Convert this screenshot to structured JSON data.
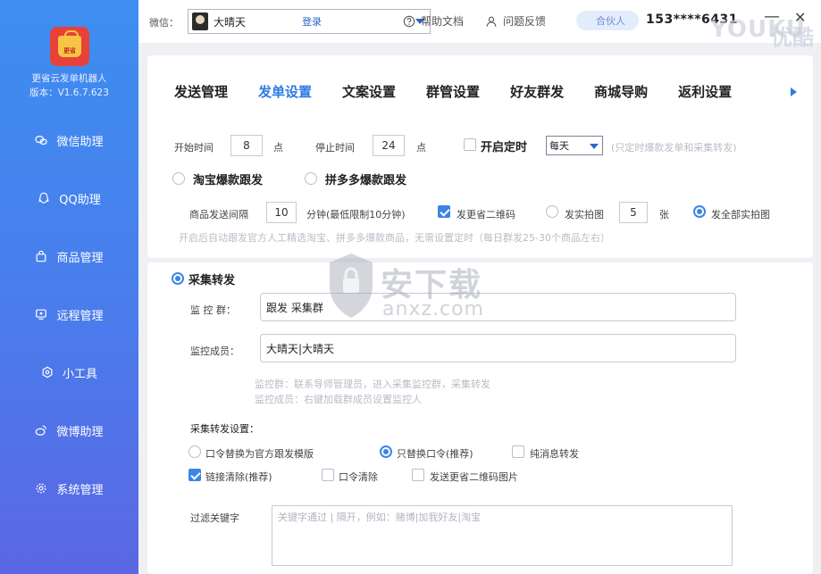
{
  "sidebar": {
    "logo_text": "更省",
    "app_name": "更省云发单机器人",
    "version": "版本：V1.6.7.623",
    "items": [
      {
        "label": "微信助理",
        "icon": "wechat-icon"
      },
      {
        "label": "QQ助理",
        "icon": "qq-icon"
      },
      {
        "label": "商品管理",
        "icon": "bag-icon"
      },
      {
        "label": "远程管理",
        "icon": "monitor-icon"
      },
      {
        "label": "小工具",
        "icon": "tool-icon"
      },
      {
        "label": "微博助理",
        "icon": "weibo-icon"
      },
      {
        "label": "系统管理",
        "icon": "gear-icon"
      }
    ]
  },
  "topbar": {
    "wechat_label": "微信：",
    "account_name": "大晴天",
    "login": "登录",
    "help": "帮助文档",
    "feedback": "问题反馈",
    "pill": "合伙人",
    "phone": "153****6431",
    "minimize": "—",
    "close": "✕",
    "watermark": "YOUKU",
    "watermark2": "优酷"
  },
  "tabs": [
    "发送管理",
    "发单设置",
    "文案设置",
    "群管设置",
    "好友群发",
    "商城导购",
    "返利设置"
  ],
  "schedule": {
    "start_label": "开始时间",
    "start_value": "8",
    "start_unit": "点",
    "stop_label": "停止时间",
    "stop_value": "24",
    "stop_unit": "点",
    "timer_label": "开启定时",
    "frequency": "每天",
    "timer_hint": "(只定时爆款发单和采集转发)"
  },
  "follow": {
    "taobao": "淘宝爆款跟发",
    "pdd": "拼多多爆款跟发",
    "interval_label": "商品发送间隔",
    "interval_value": "10",
    "interval_unit": "分钟(最低限制10分钟)",
    "qrcode_label": "发更省二维码",
    "photo_label": "发实拍图",
    "photo_count": "5",
    "photo_unit": "张",
    "all_photos_label": "发全部实拍图",
    "hint": "开启后自动跟发官方人工精选淘宝、拼多多爆款商品，无需设置定时（每日群发25-30个商品左右）"
  },
  "collect": {
    "title": "采集转发",
    "monitor_group_label": "监 控 群：",
    "monitor_group_value": "跟发  采集群",
    "monitor_member_label": "监控成员：",
    "monitor_member_value": "大晴天|大晴天",
    "hint1": "监控群：联系导师管理员，进入采集监控群，采集转发",
    "hint2": "监控成员：右键加载群成员设置监控人",
    "settings_title": "采集转发设置：",
    "opt_template": "口令替换为官方跟发模版",
    "opt_only_token": "只替换口令(推荐)",
    "opt_plain": "纯消息转发",
    "opt_clear_link": "链接清除(推荐)",
    "opt_clear_token": "口令清除",
    "opt_send_qr": "发送更省二维码图片",
    "filter_label": "过滤关键字",
    "filter_placeholder": "关键字通过 | 隔开，例如：赌博|加我好友|淘宝"
  },
  "center_watermark": {
    "title": "安下载",
    "sub": "anxz.com"
  }
}
